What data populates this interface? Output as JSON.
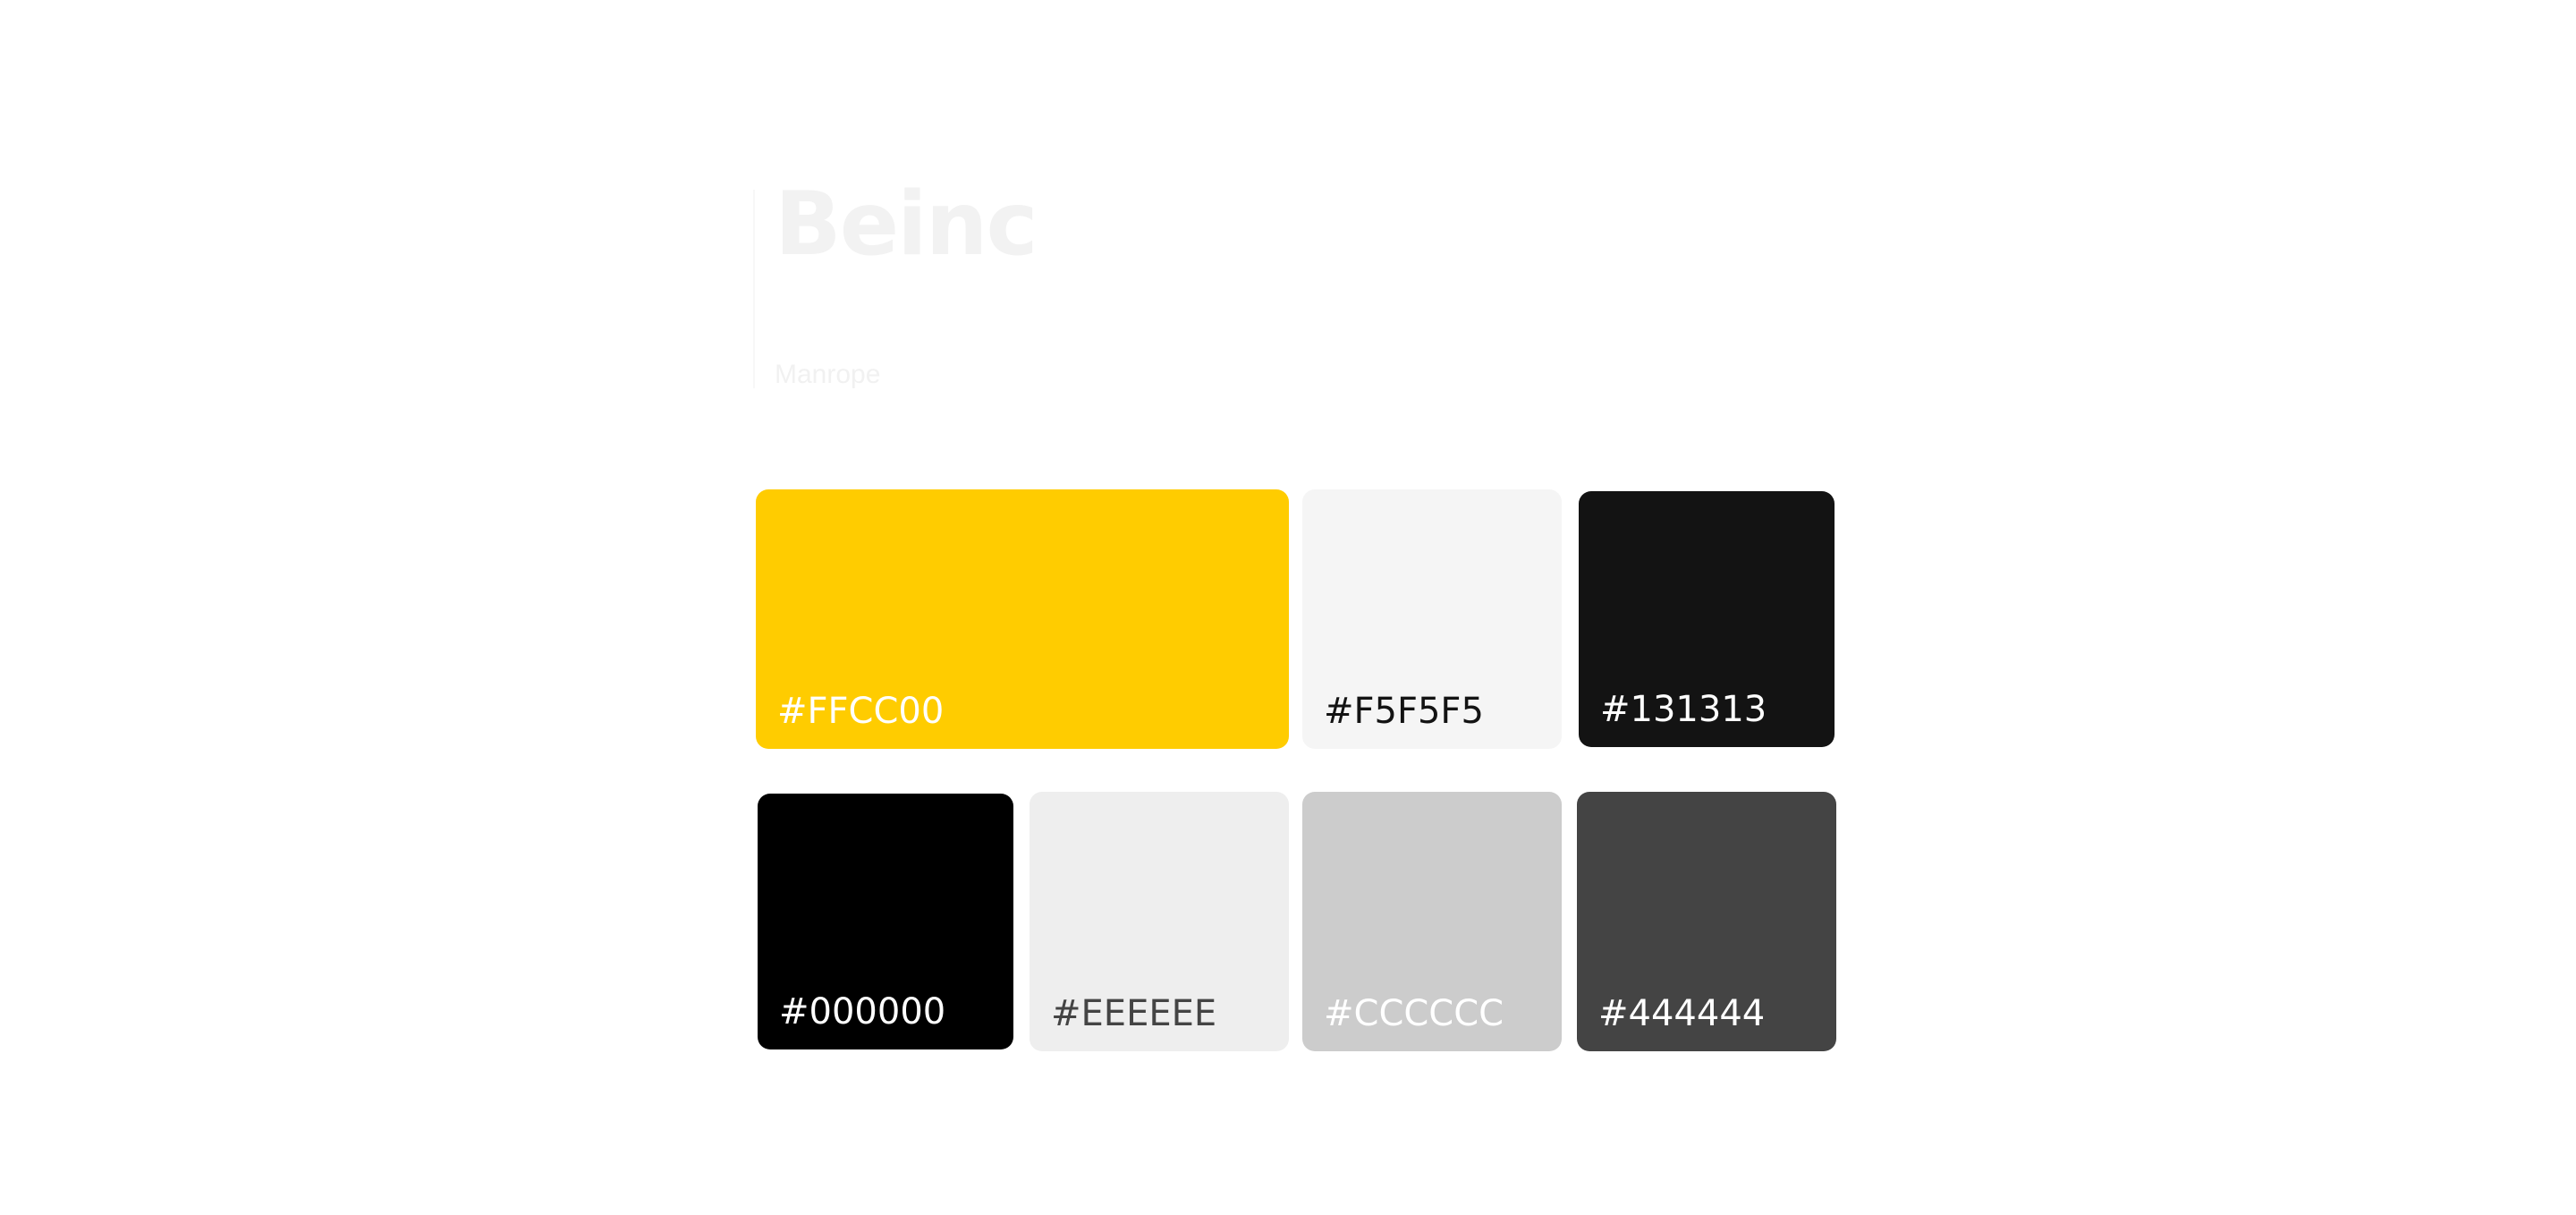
{
  "brand": {
    "title": "Beinc",
    "font_name": "Manrope"
  },
  "swatches": [
    {
      "id": "yellow",
      "code": "#FFCC00",
      "color": "#FFCC00",
      "text_color": "#FFFFFF"
    },
    {
      "id": "f5",
      "code": "#F5F5F5",
      "color": "#F5F5F5",
      "text_color": "#131313"
    },
    {
      "id": "131313",
      "code": "#131313",
      "color": "#131313",
      "text_color": "#FFFFFF"
    },
    {
      "id": "000",
      "code": "#000000",
      "color": "#000000",
      "text_color": "#FFFFFF"
    },
    {
      "id": "eee",
      "code": "#EEEEEE",
      "color": "#EEEEEE",
      "text_color": "#444444"
    },
    {
      "id": "ccc",
      "code": "#CCCCCC",
      "color": "#CCCCCC",
      "text_color": "#FFFFFF"
    },
    {
      "id": "444",
      "code": "#444444",
      "color": "#444444",
      "text_color": "#FFFFFF"
    }
  ]
}
